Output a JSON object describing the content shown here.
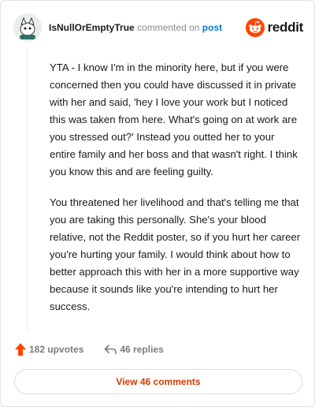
{
  "comment": {
    "username": "IsNullOrEmptyTrue",
    "action_text": "commented on",
    "post_link": "post",
    "paragraphs": [
      "YTA - I know I'm in the minority here, but if you were concerned then you could have discussed it in private with her and said, 'hey I love your work but I noticed this was taken from here. What's going on at work are you stressed out?' Instead you outted her to your entire family and her boss and that wasn't right. I think you know this and are feeling guilty.",
      "You threatened her livelihood and that's telling me that you are taking this personally. She's your blood relative, not the Reddit poster, so if you hurt her career you're hurting your family. I would think about how to better approach this with her in a more supportive way because it sounds like you're intending to hurt her success."
    ]
  },
  "brand": {
    "logo_text": "reddit",
    "color": "#ff4500"
  },
  "actions": {
    "upvotes": "182 upvotes",
    "replies": "46 replies",
    "upvote_icon": "upvote-arrow-icon",
    "reply_icon": "reply-arrow-icon"
  },
  "footer": {
    "view_comments_label": "View 46 comments"
  },
  "colors": {
    "accent": "#d93a00",
    "link": "#0079d3",
    "muted": "#878a8c"
  }
}
